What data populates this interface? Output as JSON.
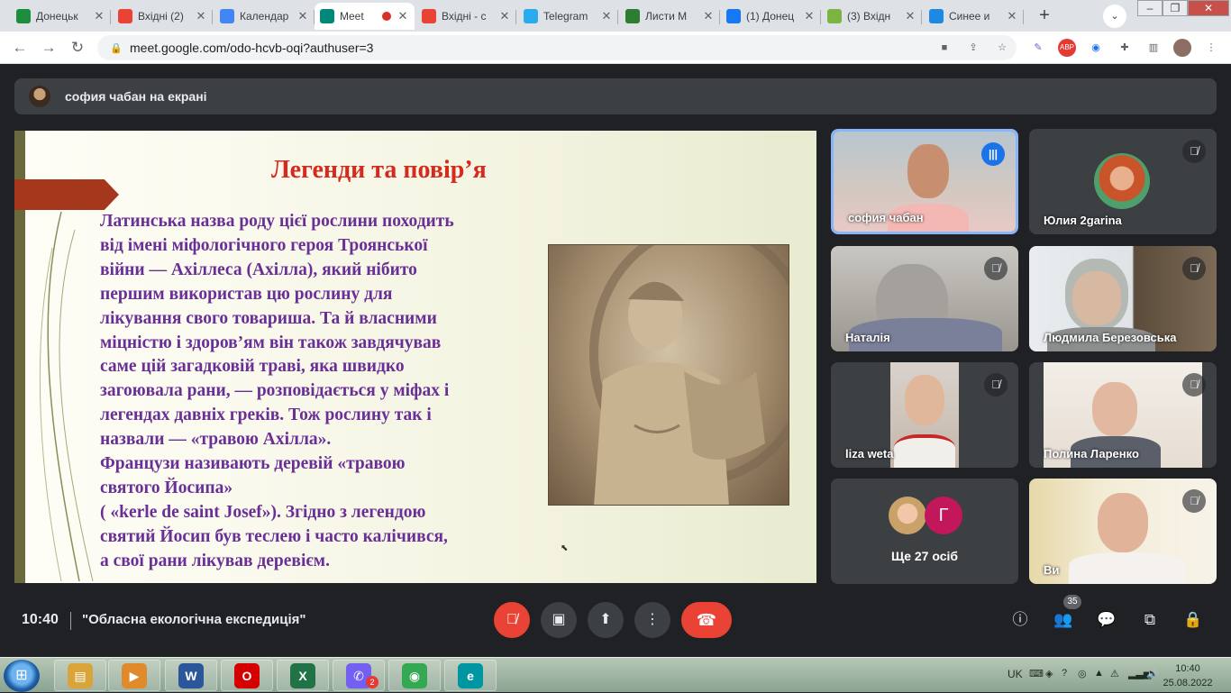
{
  "browser": {
    "tabs": [
      {
        "title": "Донецьк",
        "fav": "map-icon",
        "color": "#1e8e3e"
      },
      {
        "title": "Вхідні (2)",
        "fav": "gmail-icon",
        "color": "#ea4335"
      },
      {
        "title": "Календар",
        "fav": "calendar-icon",
        "color": "#4285f4"
      },
      {
        "title": "Meet",
        "fav": "meet-icon",
        "color": "#00897b",
        "active": true
      },
      {
        "title": "Вхідні - с",
        "fav": "gmail-icon",
        "color": "#ea4335"
      },
      {
        "title": "Telegram",
        "fav": "telegram-icon",
        "color": "#2aabee"
      },
      {
        "title": "Листи М",
        "fav": "leaf-icon",
        "color": "#2e7d32"
      },
      {
        "title": "(1) Донец",
        "fav": "facebook-icon",
        "color": "#1877f2"
      },
      {
        "title": "(3) Вхідн",
        "fav": "mail-icon",
        "color": "#7cb342"
      },
      {
        "title": "Синее и",
        "fav": "c-icon",
        "color": "#1e88e5"
      }
    ],
    "url": "meet.google.com/odo-hcvb-oqi?authuser=3"
  },
  "meet": {
    "presenter_banner": "софия чабан на екрані",
    "slide": {
      "title": "Легенди та повір’я",
      "lines": [
        "Латинська назва роду цієї рослини походить",
        "від імені міфологічного героя Троянської",
        "війни — Ахіллеса (Ахілла), який нібито",
        "першим використав цю рослину для",
        "лікування свого товариша. Та й власними",
        "міцністю і здоров’ям він також завдячував",
        "саме цій загадковій траві, яка швидко",
        "загоювала рани, — розповідається у міфах і",
        "легендах давніх греків. Тож рослину так і",
        "назвали — «травою Ахілла».",
        "Французи називають деревій «травою",
        "святого Йосипа»",
        "( «kerle de saint Josef»). Згідно з легендою",
        "святий Йосип був теслею і часто калічився,",
        "а свої рани лікував деревієм."
      ]
    },
    "participants": [
      {
        "name": "софия чабан",
        "state": "speaking"
      },
      {
        "name": "Юлия 2garina",
        "state": "muted"
      },
      {
        "name": "Наталія",
        "state": "muted"
      },
      {
        "name": "Людмила Березовська",
        "state": "muted"
      },
      {
        "name": "liza weta",
        "state": "muted"
      },
      {
        "name": "Полина Ларенко",
        "state": "muted"
      },
      {
        "name": "Ви",
        "state": "muted"
      }
    ],
    "more": {
      "label": "Ще 27 осіб",
      "avatar_letter": "Г"
    },
    "time": "10:40",
    "meeting_name": "\"Обласна екологічна експедиція\"",
    "people_count": "35"
  },
  "taskbar": {
    "apps": [
      {
        "name": "explorer-icon",
        "label": "▤",
        "color": "#d9a53a"
      },
      {
        "name": "media-player-icon",
        "label": "▶",
        "color": "#e08a2c"
      },
      {
        "name": "word-icon",
        "label": "W",
        "color": "#2b579a"
      },
      {
        "name": "opera-icon",
        "label": "O",
        "color": "#d50000"
      },
      {
        "name": "excel-icon",
        "label": "X",
        "color": "#217346"
      },
      {
        "name": "viber-icon",
        "label": "✆",
        "color": "#7360f2"
      },
      {
        "name": "chrome-icon",
        "label": "◉",
        "color": "#34a853"
      },
      {
        "name": "eset-icon",
        "label": "e",
        "color": "#0096a1"
      }
    ],
    "viber_badge": "2",
    "lang": "UK",
    "time": "10:40",
    "date": "25.08.2022"
  }
}
